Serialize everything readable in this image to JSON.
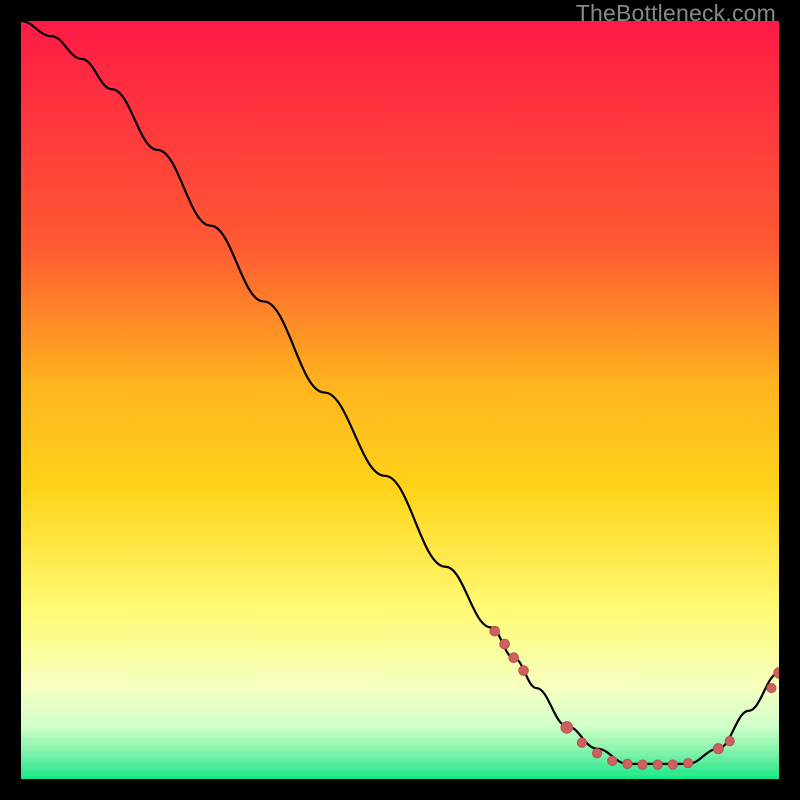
{
  "watermark": "TheBottleneck.com",
  "colors": {
    "gradient_top": "#ff1a46",
    "gradient_mid_upper": "#ff7a2a",
    "gradient_mid": "#ffd41a",
    "gradient_mid_lower": "#fff85a",
    "gradient_pale": "#f4ffd0",
    "gradient_bottom": "#10e985",
    "curve": "#000000",
    "dot_fill": "#cf6060",
    "dot_stroke": "#b94f4f",
    "label_fill": "#b94f4f"
  },
  "chart_data": {
    "type": "line",
    "title": "",
    "xlabel": "",
    "ylabel": "",
    "xlim": [
      0,
      100
    ],
    "ylim": [
      0,
      100
    ],
    "note": "Axes unlabeled; values estimated from pixel positions on a 0–100 normalized scale (y = 0 at bottom of plot).",
    "series": [
      {
        "name": "curve",
        "x": [
          0,
          4,
          8,
          12,
          18,
          25,
          32,
          40,
          48,
          56,
          62,
          65,
          68,
          72,
          76,
          80,
          84,
          88,
          92,
          96,
          100
        ],
        "y": [
          100,
          98,
          95,
          91,
          83,
          73,
          63,
          51,
          40,
          28,
          20,
          16,
          12,
          7,
          4,
          2,
          2,
          2,
          4,
          9,
          14
        ]
      }
    ],
    "highlight_points": {
      "name": "dots",
      "x": [
        62.5,
        63.8,
        65.0,
        66.3,
        72.0,
        74.0,
        76.0,
        78.0,
        80.0,
        82.0,
        84.0,
        86.0,
        88.0,
        92.0,
        93.5,
        99.0,
        100.0
      ],
      "y": [
        19.5,
        17.8,
        16.0,
        14.3,
        6.8,
        4.8,
        3.4,
        2.4,
        2.0,
        1.9,
        1.9,
        1.9,
        2.1,
        4.0,
        5.0,
        12.0,
        14.0
      ],
      "r": [
        4.8,
        4.8,
        4.8,
        4.8,
        5.8,
        4.6,
        4.6,
        4.6,
        4.6,
        4.6,
        4.6,
        4.6,
        4.6,
        5.0,
        4.6,
        4.6,
        5.2
      ]
    },
    "bottom_label": {
      "text": "",
      "x": 80,
      "y": 1.3
    }
  }
}
